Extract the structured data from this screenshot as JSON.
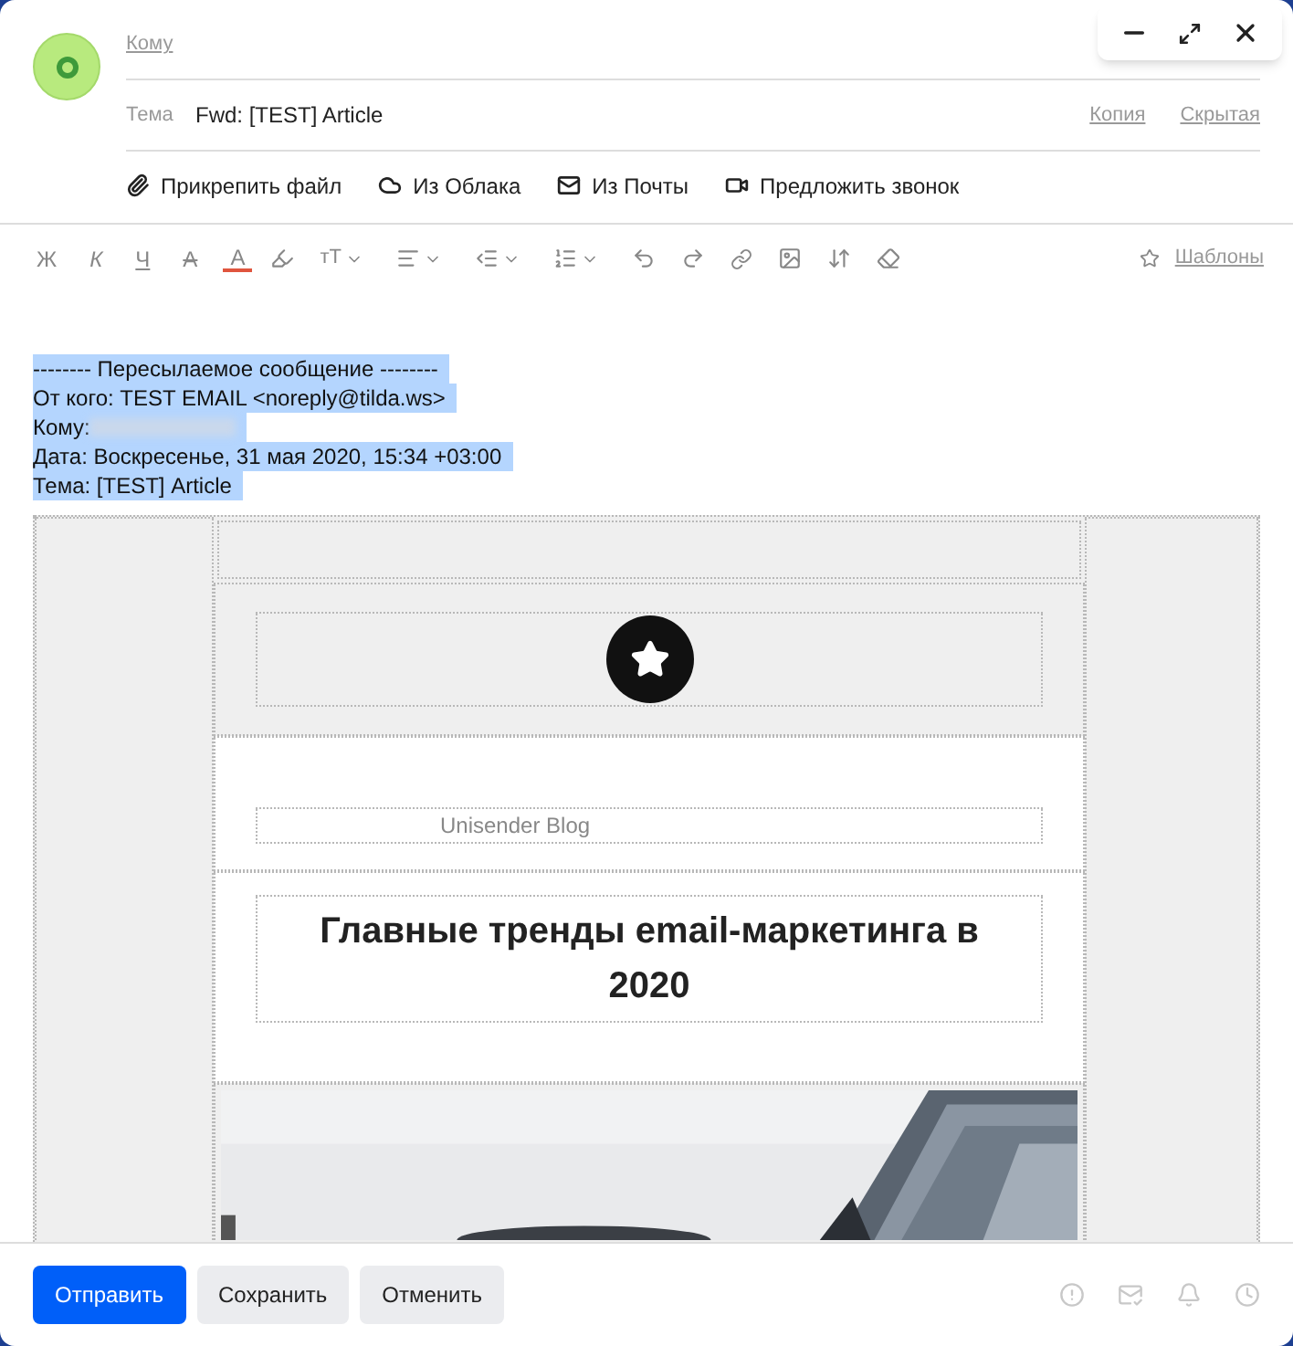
{
  "header": {
    "to_label": "Кому",
    "subject_label": "Тема",
    "subject_value": "Fwd: [TEST] Article",
    "cc_link": "Копия",
    "bcc_link": "Скрытая"
  },
  "attach_actions": [
    {
      "kind": "clip",
      "label": "Прикрепить файл"
    },
    {
      "kind": "cloud",
      "label": "Из Облака"
    },
    {
      "kind": "mail",
      "label": "Из Почты"
    },
    {
      "kind": "video",
      "label": "Предложить звонок"
    }
  ],
  "format_toolbar": {
    "letters": [
      {
        "kind": "bold",
        "label": "Ж"
      },
      {
        "kind": "italic",
        "label": "К"
      },
      {
        "kind": "underline",
        "label": "Ч"
      },
      {
        "kind": "strike",
        "label": "А"
      },
      {
        "kind": "color",
        "label": "А"
      }
    ],
    "size_label": "тТ",
    "templates_link": "Шаблоны"
  },
  "forwarded": {
    "lines": [
      {
        "kind": "text",
        "text": "-------- Пересылаемое сообщение --------"
      },
      {
        "kind": "text",
        "text": "От кого: TEST EMAIL <noreply@tilda.ws>"
      },
      {
        "kind": "blurred",
        "text": "Кому:"
      },
      {
        "kind": "text",
        "text": "Дата: Воскресенье, 31 мая 2020, 15:34 +03:00"
      },
      {
        "kind": "text",
        "text": "Тема: [TEST] Article"
      }
    ]
  },
  "email": {
    "blog_name": "Unisender Blog",
    "headline": "Главные тренды email-маркетинга в 2020"
  },
  "footer": {
    "buttons": [
      {
        "kind": "primary",
        "label": "Отправить"
      },
      {
        "kind": "secondary",
        "label": "Сохранить"
      },
      {
        "kind": "secondary",
        "label": "Отменить"
      }
    ]
  }
}
